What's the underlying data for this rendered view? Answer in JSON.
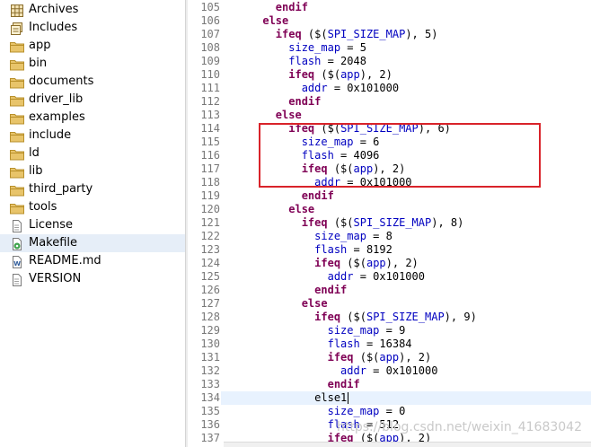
{
  "tree": {
    "items": [
      {
        "label": "Archives",
        "icon": "archives-icon"
      },
      {
        "label": "Includes",
        "icon": "includes-icon"
      },
      {
        "label": "app",
        "icon": "folder-icon"
      },
      {
        "label": "bin",
        "icon": "folder-icon"
      },
      {
        "label": "documents",
        "icon": "folder-icon"
      },
      {
        "label": "driver_lib",
        "icon": "folder-icon"
      },
      {
        "label": "examples",
        "icon": "folder-icon"
      },
      {
        "label": "include",
        "icon": "folder-icon"
      },
      {
        "label": "ld",
        "icon": "folder-icon"
      },
      {
        "label": "lib",
        "icon": "folder-icon"
      },
      {
        "label": "third_party",
        "icon": "folder-icon"
      },
      {
        "label": "tools",
        "icon": "folder-icon"
      },
      {
        "label": "License",
        "icon": "file-icon"
      },
      {
        "label": "Makefile",
        "icon": "makefile-icon",
        "selected": true
      },
      {
        "label": "README.md",
        "icon": "word-file-icon"
      },
      {
        "label": "VERSION",
        "icon": "file-icon"
      }
    ]
  },
  "editor": {
    "lines": [
      {
        "n": "105",
        "text": "        endif"
      },
      {
        "n": "106",
        "text": "      else"
      },
      {
        "n": "107",
        "text": "        ifeq ($(SPI_SIZE_MAP), 5)"
      },
      {
        "n": "108",
        "text": "          size_map = 5"
      },
      {
        "n": "109",
        "text": "          flash = 2048"
      },
      {
        "n": "110",
        "text": "          ifeq ($(app), 2)"
      },
      {
        "n": "111",
        "text": "            addr = 0x101000"
      },
      {
        "n": "112",
        "text": "          endif"
      },
      {
        "n": "113",
        "text": "        else"
      },
      {
        "n": "114",
        "text": "          ifeq ($(SPI_SIZE_MAP), 6)"
      },
      {
        "n": "115",
        "text": "            size_map = 6"
      },
      {
        "n": "116",
        "text": "            flash = 4096"
      },
      {
        "n": "117",
        "text": "            ifeq ($(app), 2)"
      },
      {
        "n": "118",
        "text": "              addr = 0x101000"
      },
      {
        "n": "119",
        "text": "            endif"
      },
      {
        "n": "120",
        "text": "          else"
      },
      {
        "n": "121",
        "text": "            ifeq ($(SPI_SIZE_MAP), 8)"
      },
      {
        "n": "122",
        "text": "              size_map = 8"
      },
      {
        "n": "123",
        "text": "              flash = 8192"
      },
      {
        "n": "124",
        "text": "              ifeq ($(app), 2)"
      },
      {
        "n": "125",
        "text": "                addr = 0x101000"
      },
      {
        "n": "126",
        "text": "              endif"
      },
      {
        "n": "127",
        "text": "            else"
      },
      {
        "n": "128",
        "text": "              ifeq ($(SPI_SIZE_MAP), 9)"
      },
      {
        "n": "129",
        "text": "                size_map = 9"
      },
      {
        "n": "130",
        "text": "                flash = 16384"
      },
      {
        "n": "131",
        "text": "                ifeq ($(app), 2)"
      },
      {
        "n": "132",
        "text": "                  addr = 0x101000"
      },
      {
        "n": "133",
        "text": "                endif"
      },
      {
        "n": "134",
        "text": "              else1",
        "current": true
      },
      {
        "n": "135",
        "text": "                size_map = 0"
      },
      {
        "n": "136",
        "text": "                flash = 512"
      },
      {
        "n": "137",
        "text": "                ifeq ($(app), 2)"
      }
    ]
  },
  "watermark": "https://blog.csdn.net/weixin_41683042",
  "colors": {
    "keyword": "#7f0055",
    "variable": "#0000c0",
    "highlight_box": "#d9232a"
  }
}
